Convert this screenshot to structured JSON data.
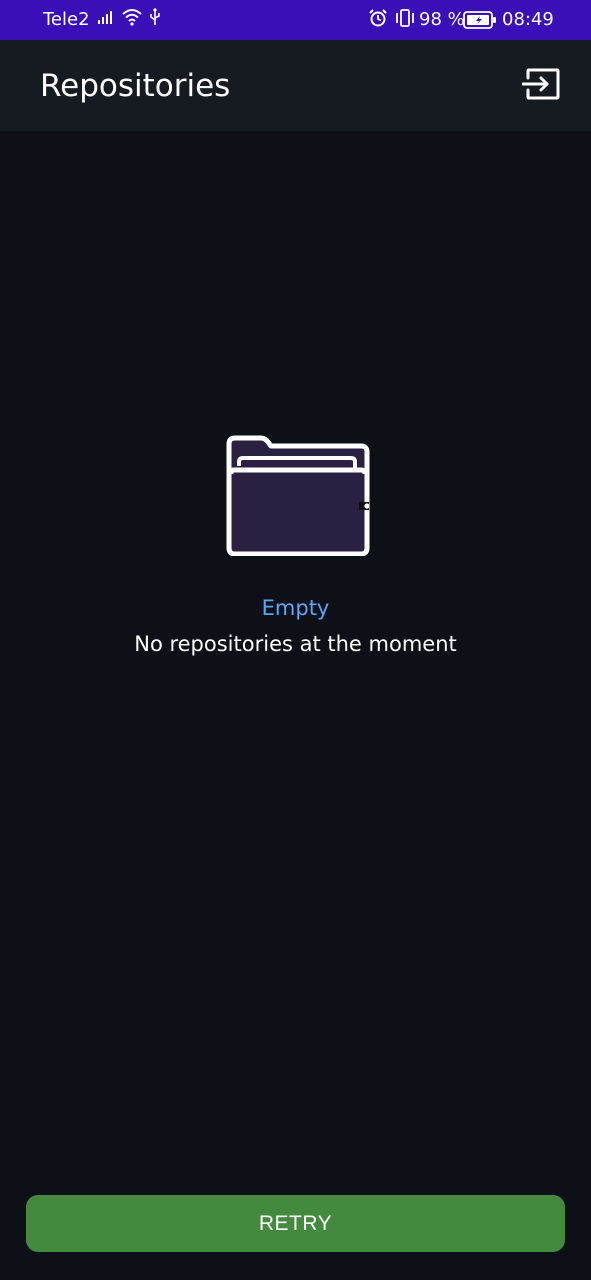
{
  "status_bar": {
    "carrier": "Tele2",
    "battery_percent": "98 %",
    "time": "08:49",
    "icons": [
      "signal-icon",
      "wifi-icon",
      "usb-icon",
      "alarm-icon",
      "vibrate-icon",
      "battery-charging-icon"
    ]
  },
  "app_bar": {
    "title": "Repositories",
    "action_icon": "logout-icon"
  },
  "empty_state": {
    "icon": "folder-icon",
    "heading": "Empty",
    "message": "No repositories at the moment"
  },
  "actions": {
    "retry_label": "RETRY"
  },
  "colors": {
    "status_bar": "#3b0fb8",
    "background": "#0d1117",
    "app_bar": "#161b22",
    "accent_text": "#58a6ff",
    "retry_button": "#438a3e",
    "folder_fill": "#2a2142"
  }
}
